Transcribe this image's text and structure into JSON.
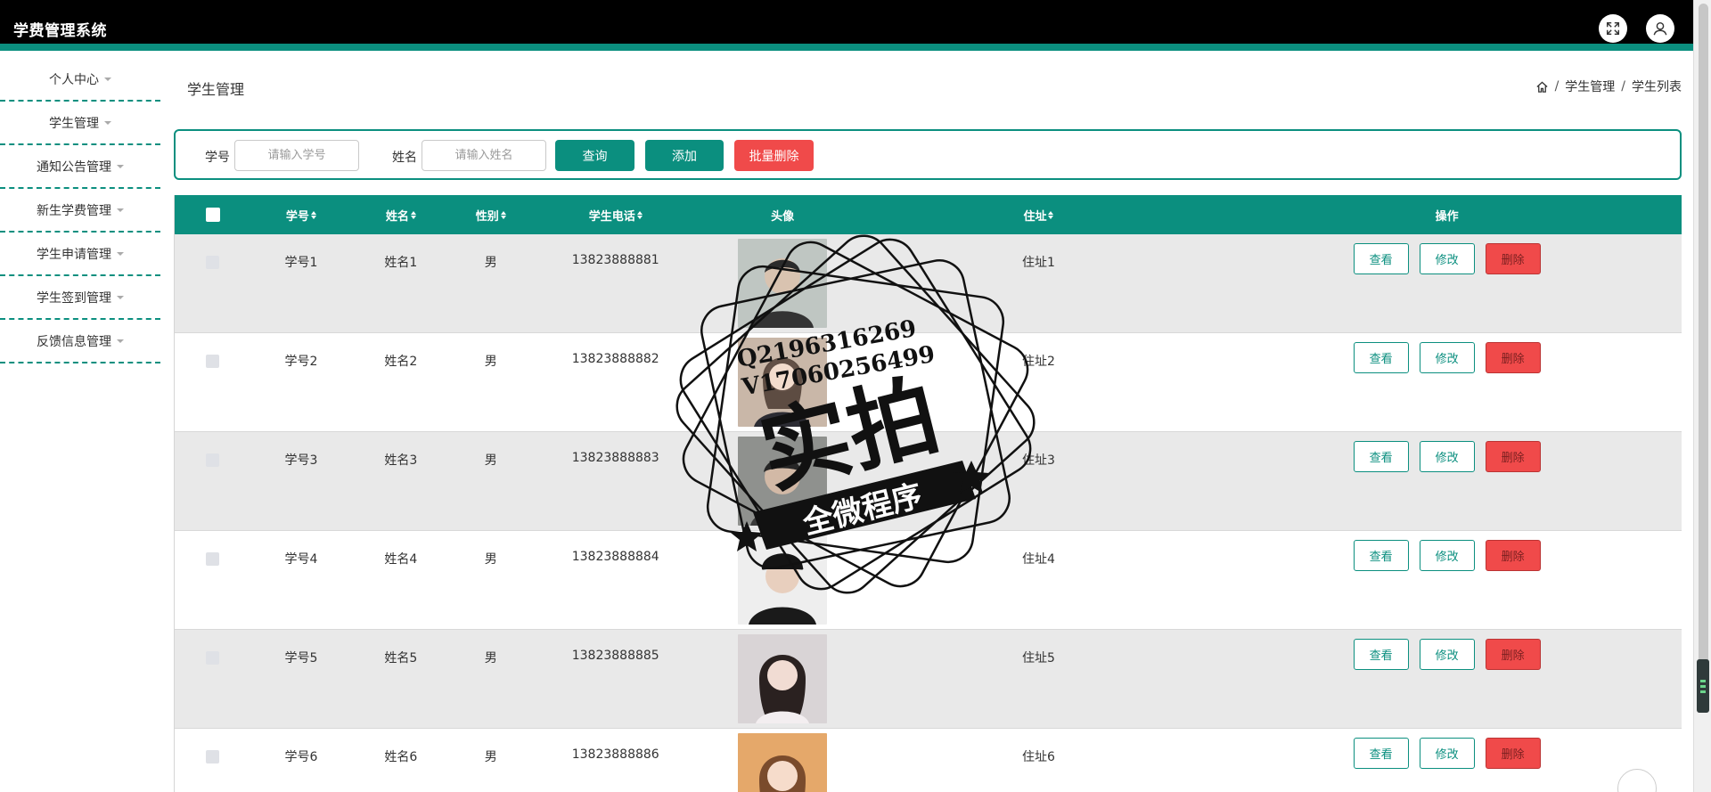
{
  "app": {
    "title": "学费管理系统"
  },
  "header": {
    "icons": [
      "fullscreen-icon",
      "user-icon"
    ]
  },
  "sidebar": {
    "items": [
      {
        "label": "个人中心"
      },
      {
        "label": "学生管理"
      },
      {
        "label": "通知公告管理"
      },
      {
        "label": "新生学费管理"
      },
      {
        "label": "学生申请管理"
      },
      {
        "label": "学生签到管理"
      },
      {
        "label": "反馈信息管理"
      }
    ]
  },
  "page": {
    "heading": "学生管理",
    "breadcrumb": [
      "学生管理",
      "学生列表"
    ]
  },
  "search": {
    "id_label": "学号",
    "id_placeholder": "请输入学号",
    "name_label": "姓名",
    "name_placeholder": "请输入姓名",
    "query_button": "查询",
    "add_button": "添加",
    "batch_delete_button": "批量删除"
  },
  "table": {
    "headers": [
      "学号",
      "姓名",
      "性别",
      "学生电话",
      "头像",
      "住址",
      "操作"
    ],
    "rows": [
      {
        "id": "学号1",
        "name": "姓名1",
        "gender": "男",
        "phone": "13823888881",
        "address": "住址1"
      },
      {
        "id": "学号2",
        "name": "姓名2",
        "gender": "男",
        "phone": "13823888882",
        "address": "住址2"
      },
      {
        "id": "学号3",
        "name": "姓名3",
        "gender": "男",
        "phone": "13823888883",
        "address": "住址3"
      },
      {
        "id": "学号4",
        "name": "姓名4",
        "gender": "男",
        "phone": "13823888884",
        "address": "住址4"
      },
      {
        "id": "学号5",
        "name": "姓名5",
        "gender": "男",
        "phone": "13823888885",
        "address": "住址5"
      },
      {
        "id": "学号6",
        "name": "姓名6",
        "gender": "男",
        "phone": "13823888886",
        "address": "住址6"
      }
    ],
    "actions": {
      "view": "查看",
      "edit": "修改",
      "delete": "删除"
    }
  },
  "watermark": {
    "line1": "Q2196316269",
    "line2": "V17060256499",
    "main": "实拍",
    "ribbon": "全微程序"
  },
  "colors": {
    "accent": "#0b8f7f",
    "danger": "#f04a4a",
    "header_bg": "#000000"
  }
}
